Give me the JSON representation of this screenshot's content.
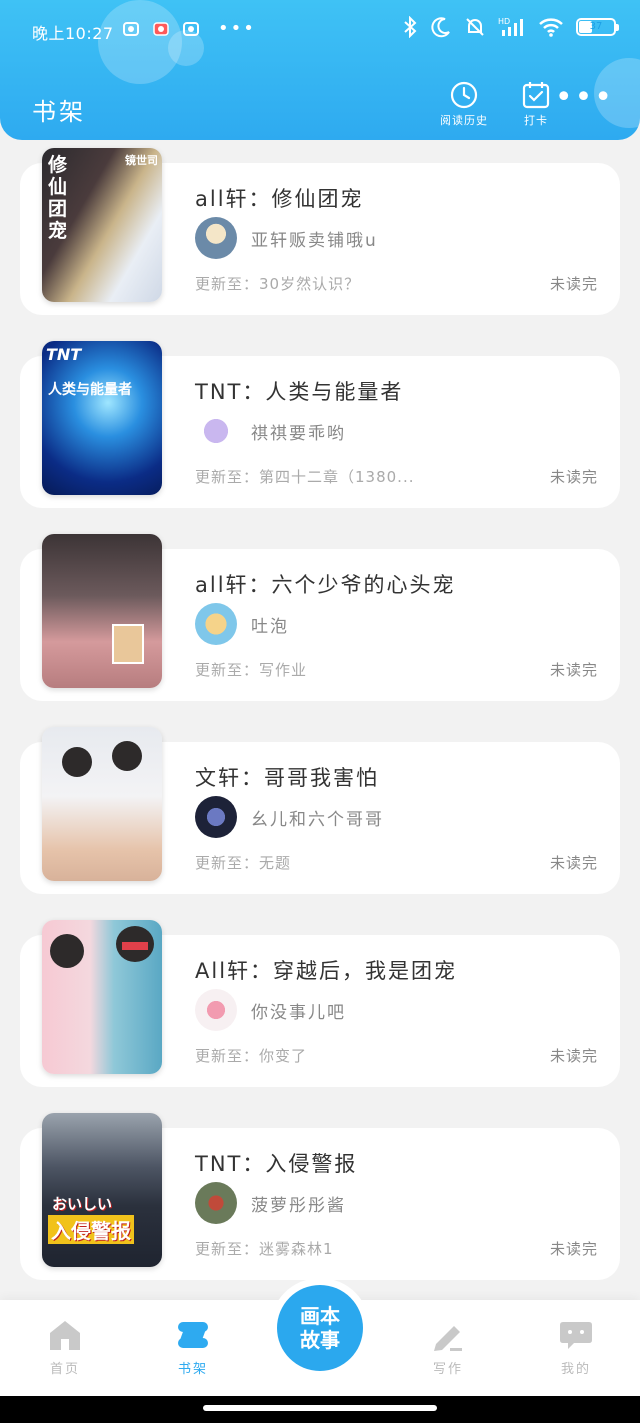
{
  "status_bar": {
    "time": "晚上10:27",
    "battery": "37",
    "battery_level": 0.37
  },
  "header": {
    "title": "书架",
    "history_label": "阅读历史",
    "checkin_label": "打卡",
    "more": "•••"
  },
  "books": [
    {
      "title": "all轩：修仙团宠",
      "cover_text": "修仙团宠",
      "cover_corner": "镜世司",
      "author": "亚轩贩卖铺哦u",
      "update": "更新至：30岁然认识？",
      "status": "未读完"
    },
    {
      "title": "TNT：人类与能量者",
      "cover_text": "人类与能量者",
      "cover_corner": "TNT",
      "author": "祺祺要乖哟",
      "update": "更新至：第四十二章（1380...",
      "status": "未读完"
    },
    {
      "title": "all轩：六个少爷的心头宠",
      "cover_text": "",
      "cover_corner": "",
      "author": "吐泡",
      "update": "更新至：写作业",
      "status": "未读完"
    },
    {
      "title": "文轩：哥哥我害怕",
      "cover_text": "",
      "cover_corner": "",
      "author": "幺儿和六个哥哥",
      "update": "更新至：无题",
      "status": "未读完"
    },
    {
      "title": "All轩：穿越后，我是团宠",
      "cover_text": "",
      "cover_corner": "",
      "author": "你没事儿吧",
      "update": "更新至：你变了",
      "status": "未读完"
    },
    {
      "title": "TNT：入侵警报",
      "cover_text": "入侵警报",
      "cover_corner": "おいしい",
      "author": "菠萝彤彤酱",
      "update": "更新至：迷雾森林1",
      "status": "未读完"
    }
  ],
  "bottom_nav": {
    "home": "首页",
    "shelf": "书架",
    "center": "画本故事",
    "write": "写作",
    "mine": "我的"
  },
  "colors": {
    "accent": "#2eaaf0",
    "header_top": "#3fc2f5",
    "inactive": "#bbbbbb"
  }
}
